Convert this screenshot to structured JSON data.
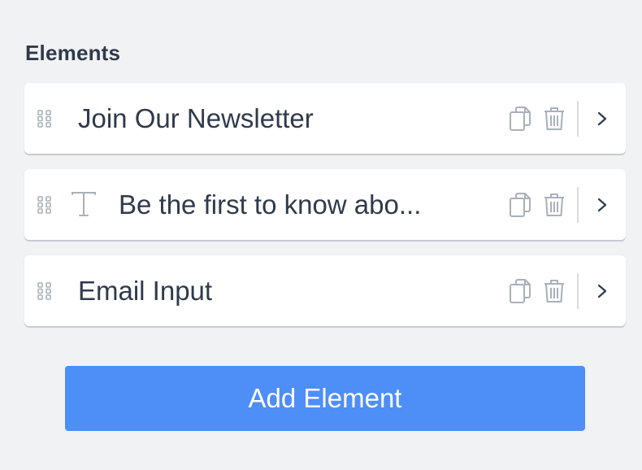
{
  "section": {
    "title": "Elements"
  },
  "elements": [
    {
      "label": "Join Our Newsletter",
      "type_icon": null
    },
    {
      "label": "Be the first to know abo...",
      "type_icon": "text-icon"
    },
    {
      "label": "Email Input",
      "type_icon": null
    }
  ],
  "actions": {
    "add_label": "Add Element"
  },
  "icons": {
    "drag": "drag-handle-icon",
    "copy": "copy-icon",
    "delete": "trash-icon",
    "open": "chevron-right-icon"
  },
  "colors": {
    "background": "#f1f2f4",
    "card": "#ffffff",
    "text": "#2f3a4b",
    "muted_icon": "#a9b0ba",
    "accent": "#4d8ef7"
  }
}
